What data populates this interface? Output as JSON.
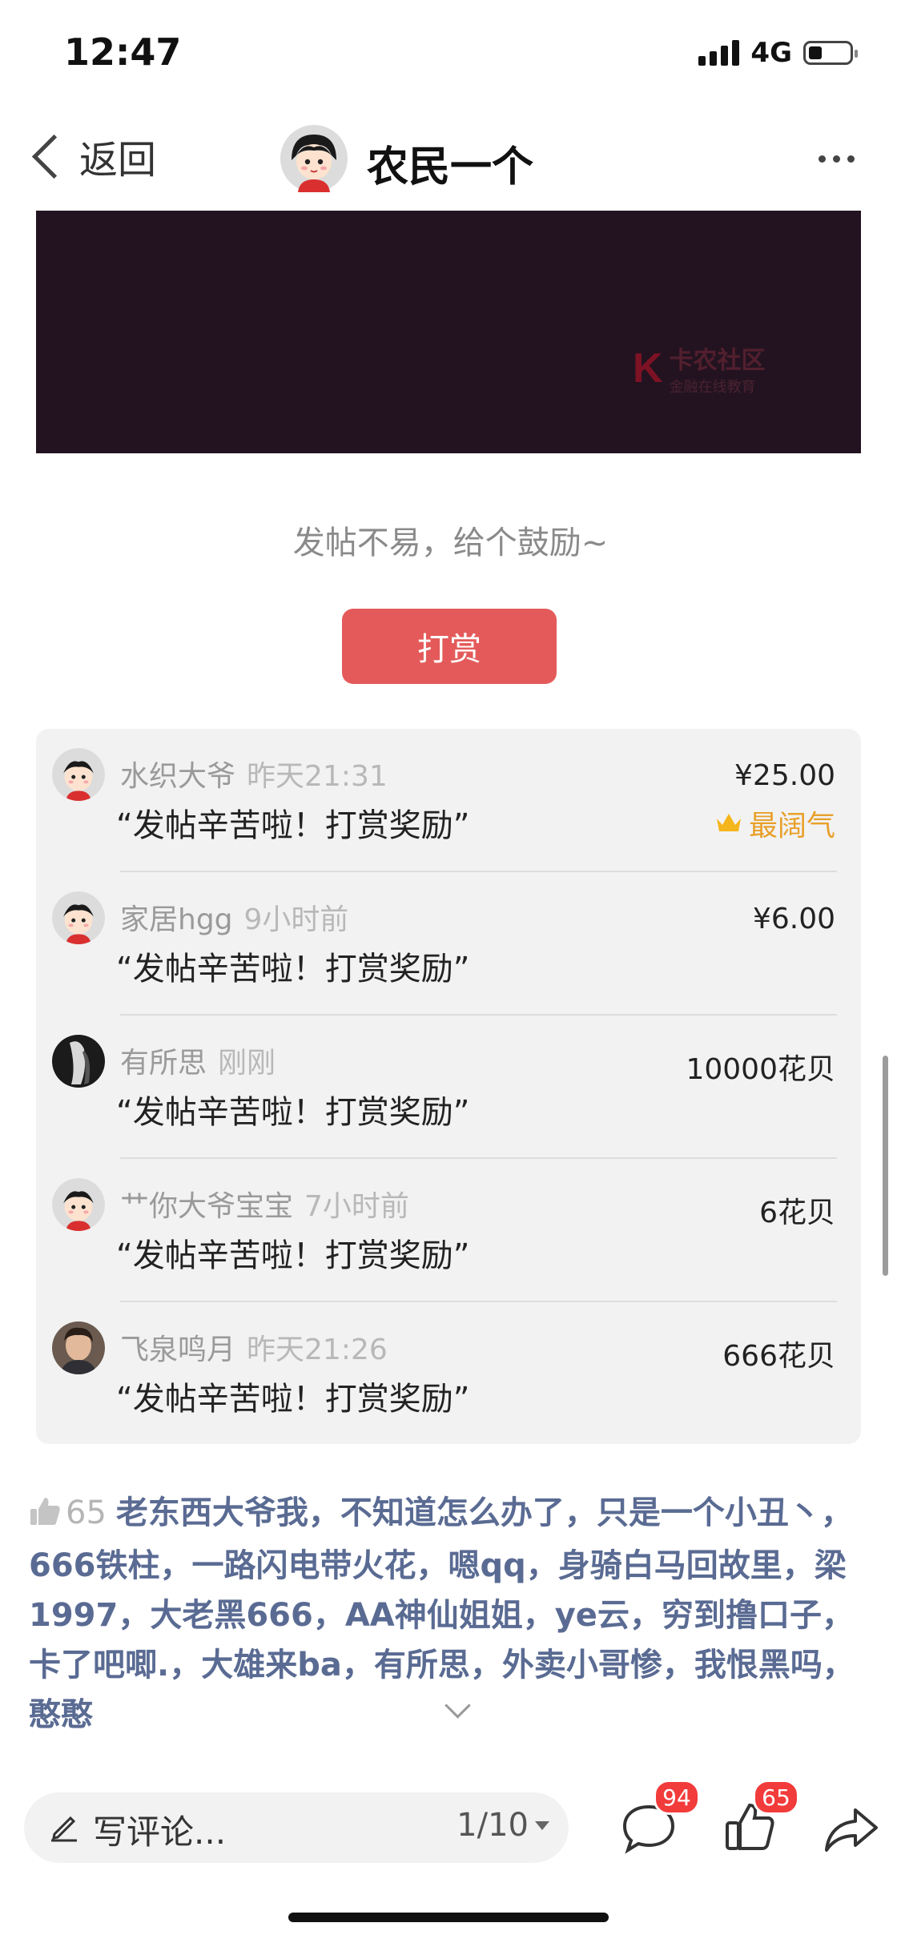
{
  "status_bar": {
    "time": "12:47",
    "network": "4G"
  },
  "nav": {
    "back_label": "返回",
    "title": "农民一个"
  },
  "banner": {
    "watermark": "卡农社区",
    "watermark_sub": "金融在线教育"
  },
  "encourage_text": "发帖不易，给个鼓励~",
  "reward_button": "打赏",
  "rewards": [
    {
      "name": "水织大爷",
      "time": "昨天21:31",
      "message": "“发帖辛苦啦！打赏奖励”",
      "amount": "¥25.00",
      "badge": "最阔气",
      "avatar": "cartoon-boy"
    },
    {
      "name": "家居hgg",
      "time": "9小时前",
      "message": "“发帖辛苦啦！打赏奖励”",
      "amount": "¥6.00",
      "avatar": "cartoon-boy"
    },
    {
      "name": "有所思",
      "time": "刚刚",
      "message": "“发帖辛苦啦！打赏奖励”",
      "amount": "10000花贝",
      "avatar": "dark-photo"
    },
    {
      "name": "艹你大爷宝宝",
      "time": "7小时前",
      "message": "“发帖辛苦啦！打赏奖励”",
      "amount": "6花贝",
      "avatar": "cartoon-boy"
    },
    {
      "name": "飞泉鸣月",
      "time": "昨天21:26",
      "message": "“发帖辛苦啦！打赏奖励”",
      "amount": "666花贝",
      "avatar": "photo"
    }
  ],
  "likes": {
    "count": "65",
    "names": "老东西大爷我，不知道怎么办了，只是一个小丑丶，666铁柱，一路闪电带火花，嗯qq，身骑白马回故里，梁1997，大老黑666，AA神仙姐姐，ye云，穷到撸口子，卡了吧唧.，大雄来ba，有所思，外卖小哥惨，我恨黑吗，憨憨"
  },
  "bottom_bar": {
    "comment_placeholder": "写评论...",
    "pager": "1/10",
    "comment_count": "94",
    "like_count": "65"
  },
  "colors": {
    "accent": "#e45a5a",
    "link": "#5a6b93",
    "badge": "#f23b3b",
    "gold": "#e8a02a"
  }
}
